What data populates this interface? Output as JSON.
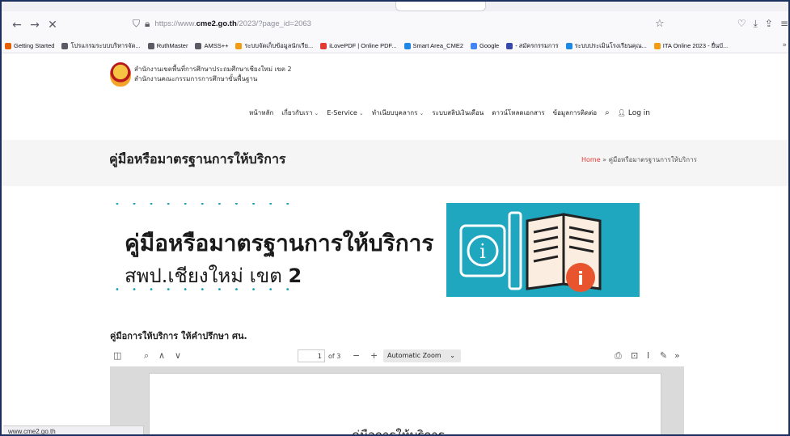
{
  "browser": {
    "url_prefix": "https://www.",
    "url_domain": "cme2.go.th",
    "url_path": "/2023/?page_id=2063",
    "status_url": "www.cme2.go.th"
  },
  "bookmarks": [
    {
      "label": "Getting Started",
      "color": "#e66000"
    },
    {
      "label": "โปรแกรมระบบบริหารจัด...",
      "color": "#5b5b66"
    },
    {
      "label": "RuthMaster",
      "color": "#5b5b66"
    },
    {
      "label": "AMSS++",
      "color": "#5b5b66"
    },
    {
      "label": "ระบบจัดเก็บข้อมูลนักเรีย...",
      "color": "#f39c12"
    },
    {
      "label": "iLovePDF | Online PDF...",
      "color": "#e53935"
    },
    {
      "label": "Smart Area_CME2",
      "color": "#1e88e5"
    },
    {
      "label": "Google",
      "color": "#4285f4"
    },
    {
      "label": "- สมัครกรรมการ",
      "color": "#3949ab"
    },
    {
      "label": "ระบบประเมินโรงเรียนคุณ...",
      "color": "#1e88e5"
    },
    {
      "label": "ITA Online 2023 - ยื่นบั...",
      "color": "#f39c12"
    }
  ],
  "site": {
    "org_line1": "สำนักงานเขตพื้นที่การศึกษาประถมศึกษาเชียงใหม่ เขต 2",
    "org_line2": "สำนักงานคณะกรรมการการศึกษาขั้นพื้นฐาน",
    "menu": [
      {
        "label": "หน้าหลัก",
        "dropdown": false
      },
      {
        "label": "เกี่ยวกับเรา",
        "dropdown": true
      },
      {
        "label": "E-Service",
        "dropdown": true
      },
      {
        "label": "ทำเนียบบุคลากร",
        "dropdown": true
      },
      {
        "label": "ระบบสลิปเงินเดือน",
        "dropdown": false
      },
      {
        "label": "ดาวน์โหลดเอกสาร",
        "dropdown": false
      },
      {
        "label": "ข้อมูลการติดต่อ",
        "dropdown": false
      }
    ],
    "login_label": "Log in"
  },
  "page": {
    "title": "คู่มือหรือมาตรฐานการให้บริการ",
    "breadcrumb_home": "Home",
    "breadcrumb_sep": "»",
    "breadcrumb_current": "คู่มือหรือมาตรฐานการให้บริการ"
  },
  "banner": {
    "line1": "คู่มือหรือมาตรฐานการให้บริการ",
    "line2": "สพป.เชียงใหม่ เขต",
    "line2_bold": "2",
    "accent": "#1fa7c0"
  },
  "pdf": {
    "section_title": "คู่มือการให้บริการ ให้คำปรึกษา ศน.",
    "page_number": "1",
    "page_total": "of 3",
    "zoom": "Automatic Zoom",
    "page_heading": "คู่มือการให้บริการ"
  }
}
